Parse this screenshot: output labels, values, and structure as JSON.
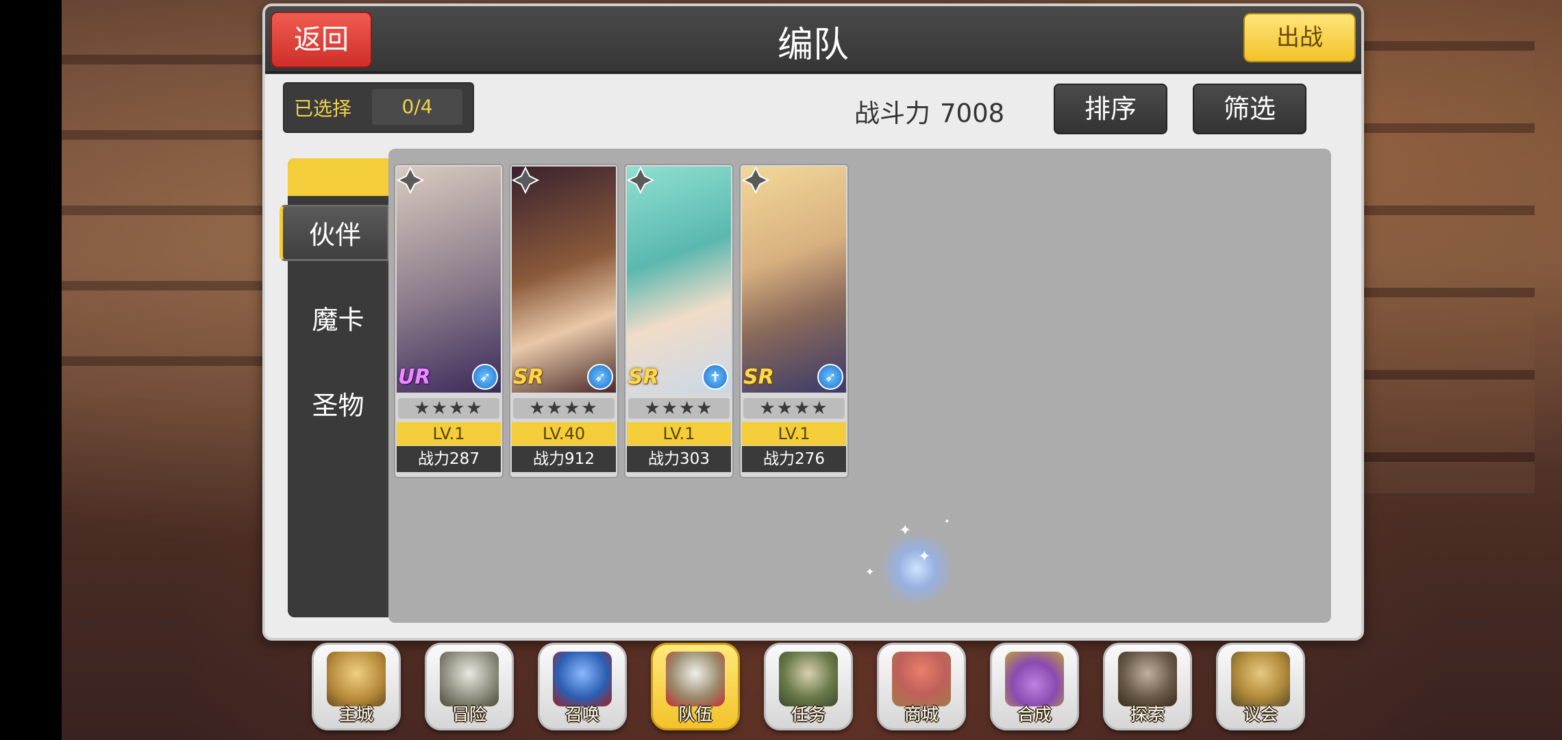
{
  "header": {
    "title": "编队",
    "back_label": "返回",
    "battle_label": "出战"
  },
  "selection": {
    "label": "已选择",
    "value": "0/4"
  },
  "power": {
    "label": "战斗力",
    "value": "7008"
  },
  "buttons": {
    "sort_label": "排序",
    "filter_label": "筛选"
  },
  "side_nav": {
    "items": [
      {
        "label": "伙伴"
      },
      {
        "label": "魔卡"
      },
      {
        "label": "圣物"
      }
    ]
  },
  "cards": [
    {
      "rarity": "UR",
      "stars": "★★★★",
      "level": "LV.1",
      "cp": "战力287",
      "element_icon": "bow-icon",
      "accent": "#b7a89a"
    },
    {
      "rarity": "SR",
      "stars": "★★★★",
      "level": "LV.40",
      "cp": "战力912",
      "element_icon": "bow-icon",
      "accent": "#4a2e3a"
    },
    {
      "rarity": "SR",
      "stars": "★★★★",
      "level": "LV.1",
      "cp": "战力303",
      "element_icon": "cross-icon",
      "accent": "#7fd6c8"
    },
    {
      "rarity": "SR",
      "stars": "★★★★",
      "level": "LV.1",
      "cp": "战力276",
      "element_icon": "bow-icon",
      "accent": "#e8c88a"
    }
  ],
  "bottom_nav": {
    "items": [
      {
        "label": "主城",
        "icon": "crown-icon",
        "color": "#b58a3a"
      },
      {
        "label": "冒险",
        "icon": "crossed-swords-icon",
        "color": "#8a8a7a"
      },
      {
        "label": "召唤",
        "icon": "summon-card-icon",
        "color": "#2c5fb3"
      },
      {
        "label": "队伍",
        "icon": "team-wings-icon",
        "color": "#9a6a2a"
      },
      {
        "label": "任务",
        "icon": "quest-book-icon",
        "color": "#6a7a4a"
      },
      {
        "label": "商城",
        "icon": "shop-tree-icon",
        "color": "#c0605a"
      },
      {
        "label": "合成",
        "icon": "potion-icon",
        "color": "#8a4ab0"
      },
      {
        "label": "探索",
        "icon": "shovel-icon",
        "color": "#6a5a4a"
      },
      {
        "label": "议会",
        "icon": "council-emblem-icon",
        "color": "#b08a3a"
      }
    ],
    "active_index": 3
  }
}
